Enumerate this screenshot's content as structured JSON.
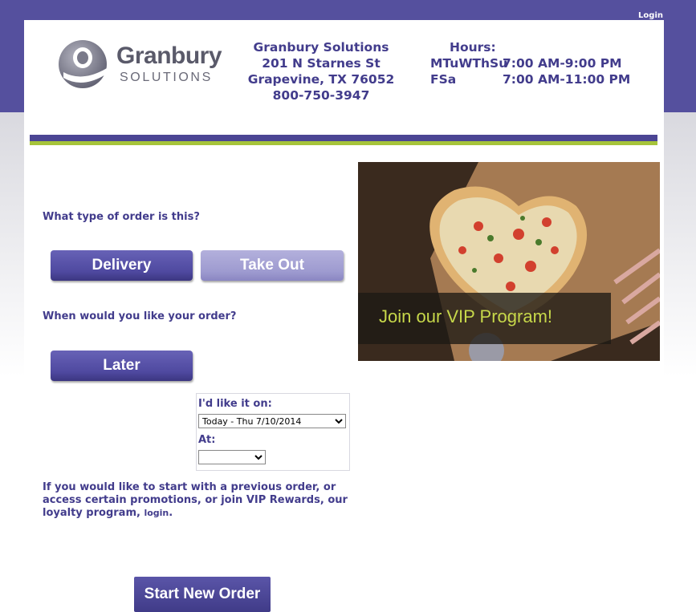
{
  "header": {
    "login_label": "Login",
    "logo": {
      "line1": "Granbury",
      "line2": "SOLUTIONS"
    },
    "store": {
      "name": "Granbury Solutions",
      "address1": "201 N Starnes St",
      "address2": "Grapevine, TX 76052",
      "phone": "800-750-3947"
    },
    "hours": {
      "title": "Hours:",
      "rows": [
        {
          "days": "MTuWThSu",
          "time": "7:00 AM-9:00 PM"
        },
        {
          "days": "FSa",
          "time": "7:00 AM-11:00 PM"
        }
      ]
    }
  },
  "order_type": {
    "question": "What type of order is this?",
    "delivery_label": "Delivery",
    "takeout_label": "Take Out"
  },
  "timing": {
    "question": "When would you like your order?",
    "later_label": "Later",
    "date_label": "I'd like it on:",
    "date_value": "Today - Thu 7/10/2014",
    "time_label": "At:",
    "time_value": ""
  },
  "info": {
    "text": "If you would like to start with a previous order, or access certain promotions, or join VIP Rewards, our loyalty program, ",
    "link": "login",
    "end": "."
  },
  "promo": {
    "text": "Join our VIP Program!"
  },
  "start_button": "Start New Order",
  "colors": {
    "brand_purple": "#55509e",
    "text_purple": "#423c8c",
    "accent_green": "#a6c43a",
    "promo_text": "#c7d84a"
  }
}
